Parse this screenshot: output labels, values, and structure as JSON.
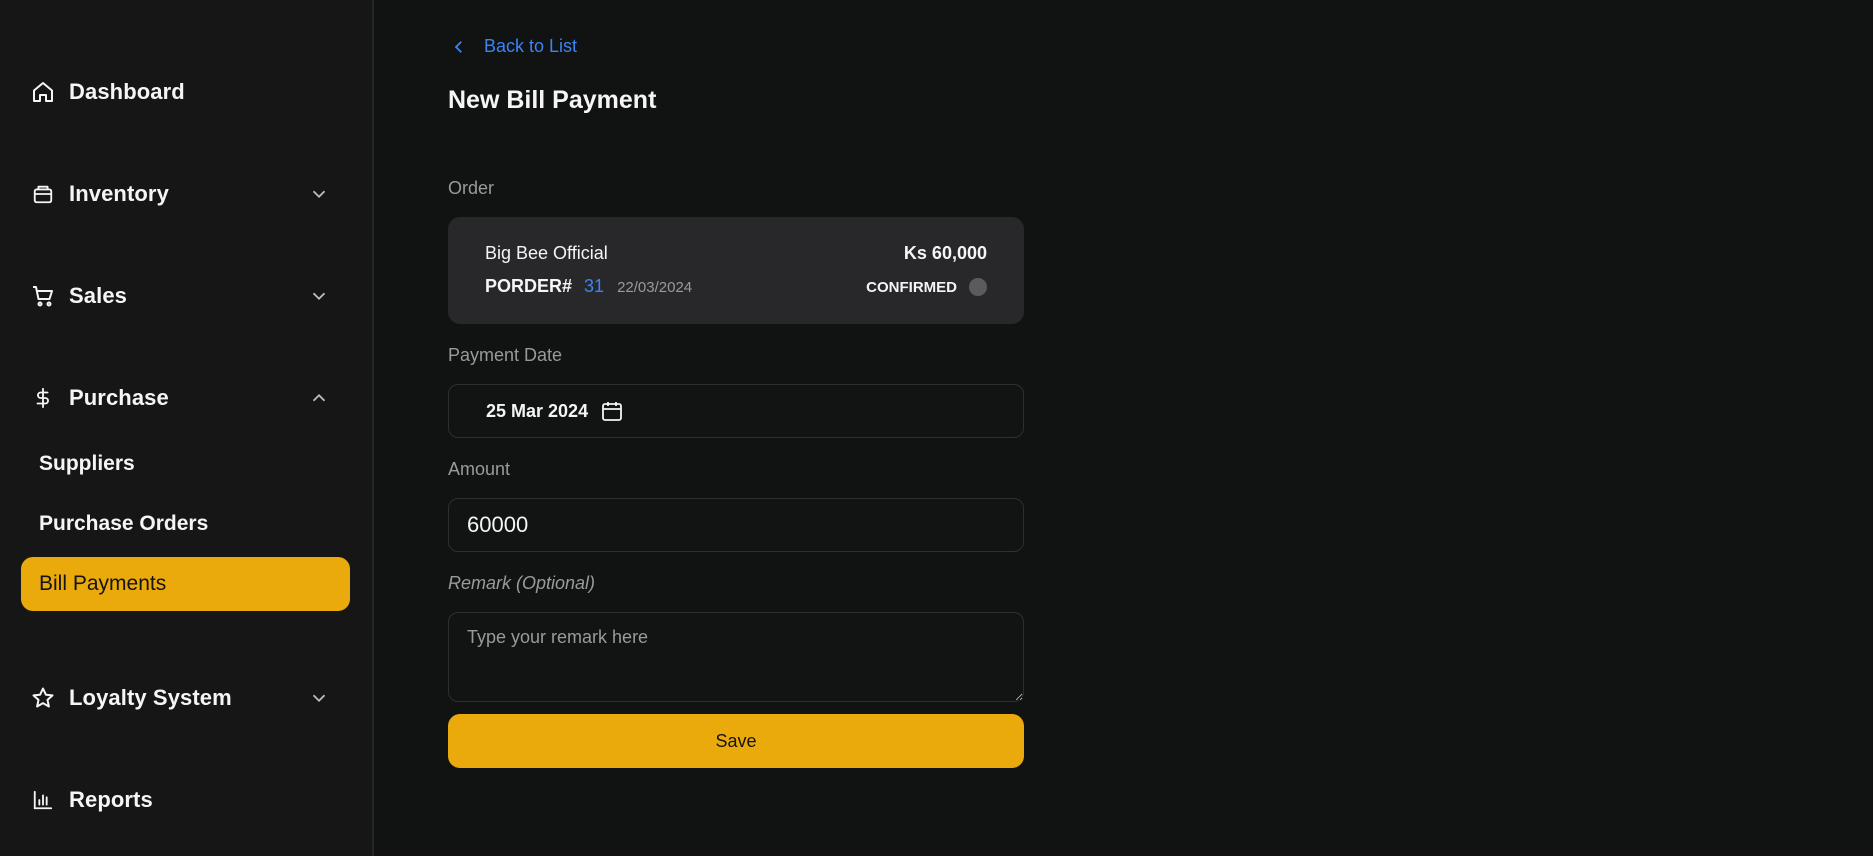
{
  "sidebar": {
    "items": [
      {
        "label": "Dashboard",
        "icon": "home-icon"
      },
      {
        "label": "Inventory",
        "icon": "box-icon",
        "expandable": true,
        "expanded": false
      },
      {
        "label": "Sales",
        "icon": "cart-icon",
        "expandable": true,
        "expanded": false
      },
      {
        "label": "Purchase",
        "icon": "dollar-icon",
        "expandable": true,
        "expanded": true,
        "children": [
          {
            "label": "Suppliers"
          },
          {
            "label": "Purchase Orders"
          },
          {
            "label": "Bill Payments",
            "active": true
          }
        ]
      },
      {
        "label": "Loyalty System",
        "icon": "star-icon",
        "expandable": true,
        "expanded": false
      },
      {
        "label": "Reports",
        "icon": "bar-chart-icon"
      }
    ]
  },
  "main": {
    "back_label": "Back to List",
    "title": "New Bill Payment",
    "order_label": "Order",
    "order": {
      "supplier": "Big Bee Official",
      "amount": "Ks 60,000",
      "prefix": "PORDER#",
      "number": "31",
      "date": "22/03/2024",
      "status": "CONFIRMED"
    },
    "payment_date_label": "Payment Date",
    "payment_date": "25 Mar 2024",
    "amount_label": "Amount",
    "amount_value": "60000",
    "remark_label": "Remark (Optional)",
    "remark_placeholder": "Type your remark here",
    "save_label": "Save"
  },
  "colors": {
    "accent": "#eaaa0b",
    "link": "#3c83f6",
    "background": "#111212",
    "sidebar": "#161616",
    "card": "#28282a"
  }
}
